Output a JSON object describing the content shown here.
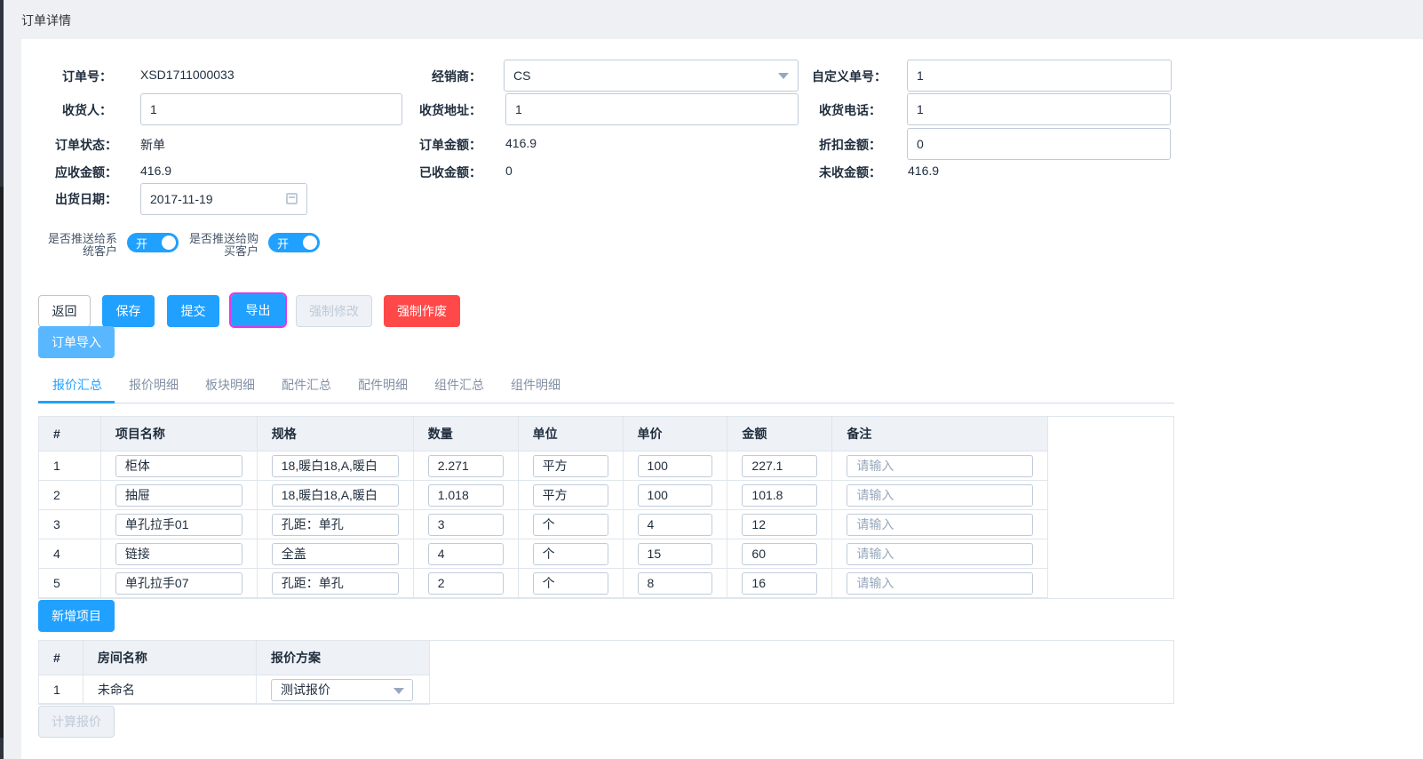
{
  "header": {
    "title": "订单详情"
  },
  "form": {
    "order_no_label": "订单号：",
    "order_no": "XSD1711000033",
    "dealer_label": "经销商：",
    "dealer": "CS",
    "custom_no_label": "自定义单号：",
    "custom_no": "1",
    "receiver_label": "收货人：",
    "receiver": "1",
    "address_label": "收货地址：",
    "address": "1",
    "phone_label": "收货电话：",
    "phone": "1",
    "status_label": "订单状态：",
    "status": "新单",
    "amount_label": "订单金额：",
    "amount": "416.9",
    "discount_label": "折扣金额：",
    "discount": "0",
    "receivable_label": "应收金额：",
    "receivable": "416.9",
    "received_label": "已收金额：",
    "received": "0",
    "unreceived_label": "未收金额：",
    "unreceived": "416.9",
    "ship_date_label": "出货日期：",
    "ship_date": "2017-11-19"
  },
  "switches": {
    "push_system_label_1": "是否推送给系",
    "push_system_label_2": "统客户",
    "push_system_text": "开",
    "push_buyer_label_1": "是否推送给购",
    "push_buyer_label_2": "买客户",
    "push_buyer_text": "开"
  },
  "buttons": {
    "back": "返回",
    "save": "保存",
    "submit": "提交",
    "export": "导出",
    "force_modify": "强制修改",
    "force_void": "强制作废",
    "order_import": "订单导入",
    "add_item": "新增项目",
    "calc_quote": "计算报价"
  },
  "tabs": [
    "报价汇总",
    "报价明细",
    "板块明细",
    "配件汇总",
    "配件明细",
    "组件汇总",
    "组件明细"
  ],
  "items_table": {
    "headers": [
      "#",
      "项目名称",
      "规格",
      "数量",
      "单位",
      "单价",
      "金额",
      "备注"
    ],
    "remark_placeholder": "请输入",
    "rows": [
      {
        "no": "1",
        "name": "柜体",
        "spec": "18,暖白18,A,暖白",
        "qty": "2.271",
        "unit": "平方",
        "price": "100",
        "amount": "227.1"
      },
      {
        "no": "2",
        "name": "抽屉",
        "spec": "18,暖白18,A,暖白",
        "qty": "1.018",
        "unit": "平方",
        "price": "100",
        "amount": "101.8"
      },
      {
        "no": "3",
        "name": "单孔拉手01",
        "spec": "孔距：单孔",
        "qty": "3",
        "unit": "个",
        "price": "4",
        "amount": "12"
      },
      {
        "no": "4",
        "name": "链接",
        "spec": "全盖",
        "qty": "4",
        "unit": "个",
        "price": "15",
        "amount": "60"
      },
      {
        "no": "5",
        "name": "单孔拉手07",
        "spec": "孔距：单孔",
        "qty": "2",
        "unit": "个",
        "price": "8",
        "amount": "16"
      }
    ]
  },
  "rooms_table": {
    "headers": [
      "#",
      "房间名称",
      "报价方案"
    ],
    "rows": [
      {
        "no": "1",
        "name": "未命名",
        "plan": "测试报价"
      }
    ]
  }
}
